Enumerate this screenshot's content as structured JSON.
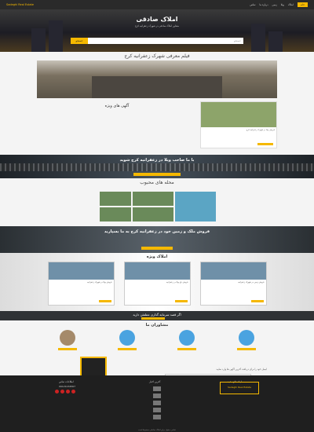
{
  "nav": {
    "logo": "Sadeghi Real Estate",
    "items": [
      "خانه",
      "املاک",
      "ویلا",
      "زمین",
      "درباره ما",
      "تماس"
    ]
  },
  "hero": {
    "title": "املاک صادقی",
    "subtitle": "مشاور املاک صادقی در شهرک زعفرانیه کرج",
    "search_placeholder": "جستجو",
    "search_button": "جستجو"
  },
  "video": {
    "title": "فیلم معرفی شهرک زعفرانیه کرج"
  },
  "featured_top": {
    "title": "آگهی های ویژه",
    "card_text": "فروش ویلا در شهرک زعفرانیه کرج"
  },
  "banner_villa": {
    "title": "با ما صاحب ویلا در زعفرانیه کرج شوید"
  },
  "popular": {
    "title": "محله های محبوب"
  },
  "sale_banner": {
    "title": "فروش ملک و زمین خود در زعفرانیه کرج به ما بسپارید"
  },
  "special": {
    "title": "املاک ویژه",
    "cards": [
      {
        "text": "فروش زمین در شهرک زعفرانیه"
      },
      {
        "text": "فروش باغ ویلا در زعفرانیه"
      },
      {
        "text": "فروش ویلا در شهرک زعفرانیه"
      }
    ]
  },
  "invest": {
    "title": "اگر قصد سرمایه گذاری مطمئن دارید"
  },
  "agents": {
    "title": "مشاوران ما"
  },
  "subscribe": {
    "text": "ایمیل خود را برای دریافت آخرین آگهی ها وارد نمایید"
  },
  "footer": {
    "logo": "Sadeghi Real Estate",
    "col1_title": "اطلاعات تماس",
    "col2_title": "آخرین اخبار",
    "col3_title": "لینک های مفید",
    "phone": "09121234567",
    "copyright": "تمامی حقوق برای املاک صادقی محفوظ است"
  }
}
